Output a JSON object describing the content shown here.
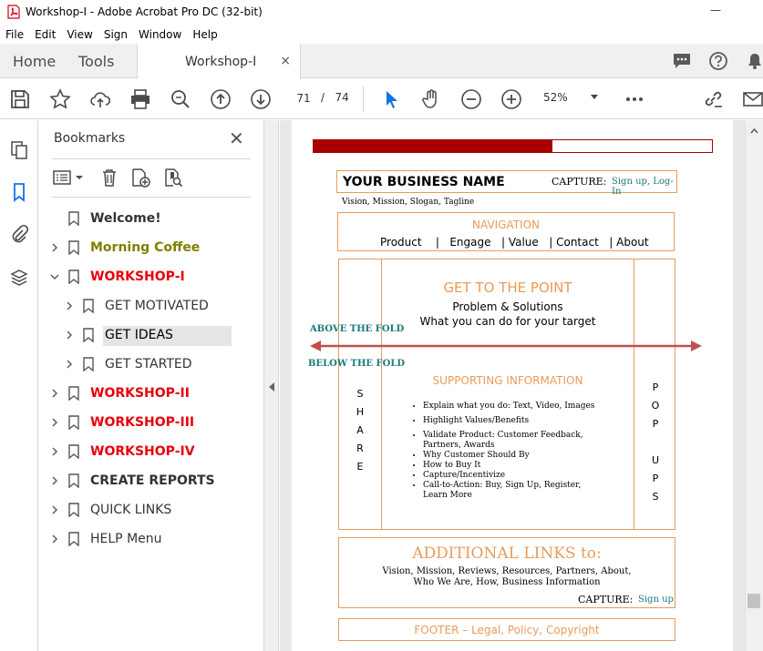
{
  "window": {
    "title": "Workshop-I - Adobe Acrobat Pro DC (32-bit)",
    "minimize_glyph": "—"
  },
  "menu": [
    "File",
    "Edit",
    "View",
    "Sign",
    "Window",
    "Help"
  ],
  "tabs": {
    "home": "Home",
    "tools": "Tools",
    "document": "Workshop-I",
    "close_glyph": "×"
  },
  "toolbar": {
    "page_current": "71",
    "page_separator": "/",
    "page_total": "74",
    "zoom": "52%"
  },
  "bookmarks_panel": {
    "title": "Bookmarks",
    "close_glyph": "✕",
    "items": [
      {
        "label": "Welcome!",
        "level": 0,
        "expand": "none",
        "color": "#333333",
        "bold": true
      },
      {
        "label": "Morning Coffee",
        "level": 0,
        "expand": "collapsed",
        "color": "#808000",
        "bold": true
      },
      {
        "label": "WORKSHOP-I",
        "level": 0,
        "expand": "expanded",
        "color": "#e8000b",
        "bold": true
      },
      {
        "label": "GET MOTIVATED",
        "level": 1,
        "expand": "collapsed",
        "color": "#333333",
        "bold": false
      },
      {
        "label": "GET IDEAS",
        "level": 1,
        "expand": "collapsed",
        "color": "#000000",
        "bold": false,
        "selected": true
      },
      {
        "label": "GET STARTED",
        "level": 1,
        "expand": "collapsed",
        "color": "#333333",
        "bold": false
      },
      {
        "label": "WORKSHOP-II",
        "level": 0,
        "expand": "collapsed",
        "color": "#e8000b",
        "bold": true
      },
      {
        "label": "WORKSHOP-III",
        "level": 0,
        "expand": "collapsed",
        "color": "#e8000b",
        "bold": true
      },
      {
        "label": "WORKSHOP-IV",
        "level": 0,
        "expand": "collapsed",
        "color": "#e8000b",
        "bold": true
      },
      {
        "label": "CREATE REPORTS",
        "level": 0,
        "expand": "collapsed",
        "color": "#333333",
        "bold": true
      },
      {
        "label": "QUICK LINKS",
        "level": 0,
        "expand": "collapsed",
        "color": "#333333",
        "bold": false
      },
      {
        "label": "HELP Menu",
        "level": 0,
        "expand": "collapsed",
        "color": "#333333",
        "bold": false
      }
    ]
  },
  "page": {
    "progress": 0.6,
    "business_name": "YOUR BUSINESS NAME",
    "capture_label": "CAPTURE:",
    "capture_links": "Sign up, Log-In",
    "tagline": "Vision, Mission, Slogan, Tagline",
    "nav_title": "NAVIGATION",
    "nav_items": [
      "Product",
      "|",
      "Engage",
      "|",
      "Value",
      "|",
      "Contact",
      "|",
      "About"
    ],
    "headline": "GET TO THE POINT",
    "subhead1": "Problem & Solutions",
    "subhead2": "What you can do for your target",
    "above_fold": "ABOVE THE FOLD",
    "below_fold": "BELOW THE FOLD",
    "supporting_title": "SUPPORTING INFORMATION",
    "share_letters": [
      "S",
      "H",
      "A",
      "R",
      "E"
    ],
    "popups_letters": [
      "P",
      "O",
      "P",
      "",
      "U",
      "P",
      "S"
    ],
    "bullets": [
      "Explain what you do: Text, Video, Images",
      "Highlight Values/Benefits",
      "Validate Product: Customer Feedback, Partners, Awards",
      "Why Customer Should By",
      "How to Buy It",
      "Capture/Incentivize",
      "Call-to-Action: Buy, Sign Up, Register, Learn More"
    ],
    "additional_title": "ADDITIONAL LINKS to:",
    "additional_line1": "Vision, Mission, Reviews, Resources, Partners, About,",
    "additional_line2": "Who We Are, How, Business Information",
    "capture2_label": "CAPTURE:",
    "capture2_link": "Sign up",
    "footer": "FOOTER – Legal, Policy, Copyright"
  },
  "colors": {
    "accent_orange": "#e89b5a",
    "teal": "#1a7a7a",
    "dark_red": "#a80000",
    "arrow_red": "#c0504d"
  }
}
